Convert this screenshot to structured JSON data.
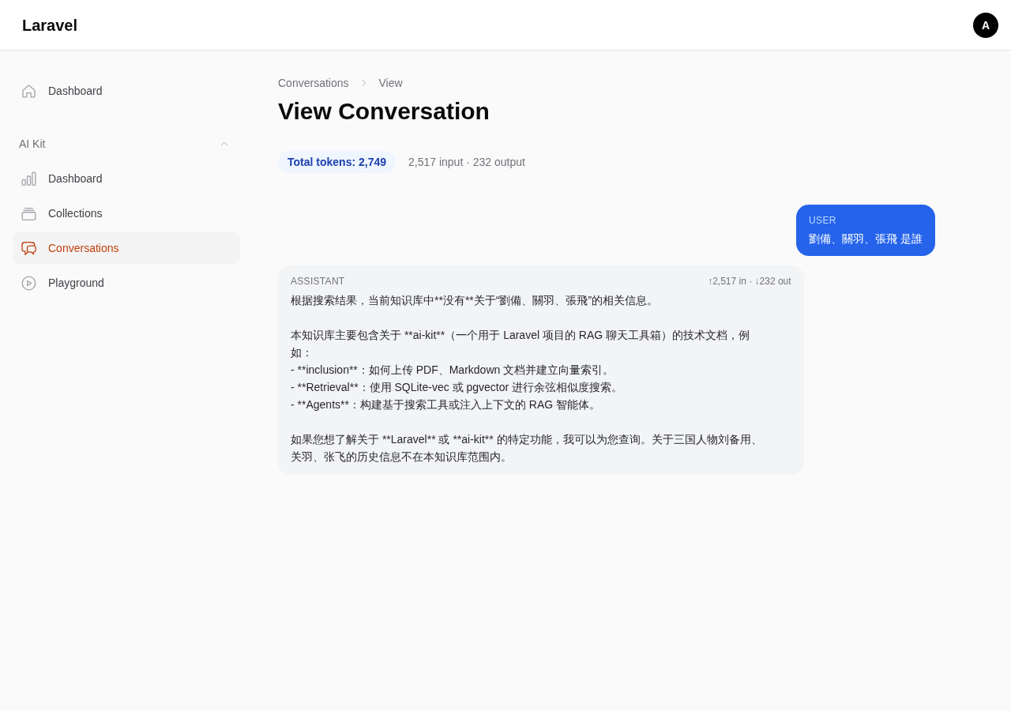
{
  "header": {
    "brand": "Laravel",
    "avatar_initial": "A"
  },
  "sidebar": {
    "items": [
      {
        "label": "Dashboard",
        "selected": false
      }
    ],
    "groups": [
      {
        "title": "AI Kit",
        "expanded": true,
        "items": [
          {
            "label": "Dashboard",
            "selected": false
          },
          {
            "label": "Collections",
            "selected": false
          },
          {
            "label": "Conversations",
            "selected": true
          },
          {
            "label": "Playground",
            "selected": false
          }
        ]
      }
    ]
  },
  "breadcrumb": [
    "Conversations",
    "View"
  ],
  "title": "View Conversation",
  "tokens": {
    "total": "Total tokens: 2,749",
    "detail": "2,517 input · 232 output"
  },
  "messages": [
    {
      "kind": "user",
      "role_label": "USER",
      "paragraphs": [
        [
          "劉備、關羽、張飛 是誰"
        ]
      ]
    },
    {
      "kind": "assistant",
      "role_label": "ASSISTANT",
      "usage": "↑2,517 in · ↓232 out",
      "paragraphs": [
        [
          "根据搜索结果，当前知识库中**没有**关于“劉備、關羽、張飛”的相关信息。"
        ],
        [
          "本知识库主要包含关于 **ai-kit**（一个用于 Laravel 项目的 RAG 聊天工具箱）的技术文档，例如：",
          "- **inclusion**：如何上传 PDF、Markdown 文档并建立向量索引。",
          "- **Retrieval**：使用 SQLite-vec 或 pgvector 进行余弦相似度搜索。",
          "- **Agents**：构建基于搜索工具或注入上下文的 RAG 智能体。"
        ],
        [
          "如果您想了解关于 **Laravel** 或 **ai-kit** 的特定功能，我可以为您查询。关于三国人物刘备用、关羽、张飞的历史信息不在本知识库范围内。"
        ]
      ]
    }
  ]
}
